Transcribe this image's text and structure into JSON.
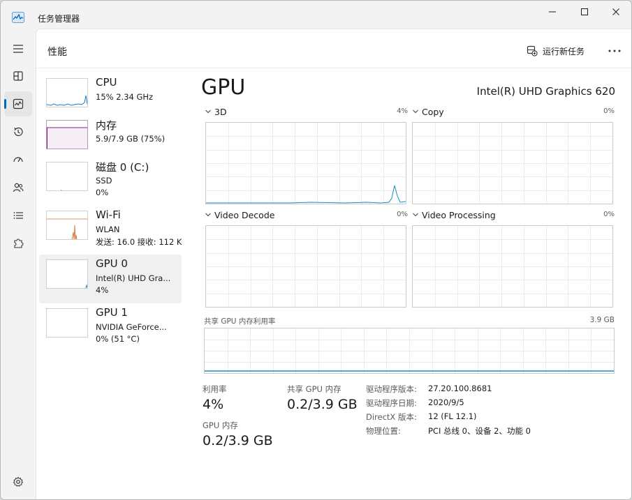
{
  "window": {
    "title": "任务管理器"
  },
  "colors": {
    "accent": "#0067c0",
    "cpu_line": "#1a7bc4",
    "memory_line": "#8b1a8b",
    "net_line": "#d4743c",
    "gpu_line": "#1a8bc4"
  },
  "nav": {
    "items": [
      {
        "name": "processes",
        "icon": "grid-icon"
      },
      {
        "name": "performance",
        "icon": "performance-icon",
        "active": true
      },
      {
        "name": "app-history",
        "icon": "history-icon"
      },
      {
        "name": "startup-apps",
        "icon": "speedometer-icon"
      },
      {
        "name": "users",
        "icon": "users-icon"
      },
      {
        "name": "details",
        "icon": "list-icon"
      },
      {
        "name": "services",
        "icon": "puzzle-icon"
      }
    ],
    "settings_icon": "gear-icon"
  },
  "header": {
    "page_title": "性能",
    "run_task": "运行新任务",
    "more_icon": "more-icon"
  },
  "devices": [
    {
      "name": "CPU",
      "line2": "15%  2.34 GHz",
      "line3": ""
    },
    {
      "name": "内存",
      "line2": "5.9/7.9 GB (75%)",
      "line3": ""
    },
    {
      "name": "磁盘 0 (C:)",
      "line2": "SSD",
      "line3": "0%"
    },
    {
      "name": "Wi-Fi",
      "line2": "WLAN",
      "line3": "发送: 16.0  接收: 112 K"
    },
    {
      "name": "GPU 0",
      "line2": "Intel(R) UHD Gra...",
      "line3": "4%"
    },
    {
      "name": "GPU 1",
      "line2": "NVIDIA GeForce...",
      "line3": "0% (51 °C)"
    }
  ],
  "gpu": {
    "title": "GPU",
    "model": "Intel(R) UHD Graphics 620",
    "engines": [
      {
        "label": "3D",
        "percent": "4%"
      },
      {
        "label": "Copy",
        "percent": "0%"
      },
      {
        "label": "Video Decode",
        "percent": "0%"
      },
      {
        "label": "Video Processing",
        "percent": "0%"
      }
    ],
    "shared_memory": {
      "label": "共享 GPU 内存利用率",
      "max": "3.9 GB"
    },
    "stats": {
      "utilization_label": "利用率",
      "utilization_value": "4%",
      "shared_mem_label": "共享 GPU 内存",
      "shared_mem_value": "0.2/3.9 GB",
      "gpu_mem_label": "GPU 内存",
      "gpu_mem_value": "0.2/3.9 GB"
    },
    "info": [
      {
        "key": "驱动程序版本:",
        "value": "27.20.100.8681"
      },
      {
        "key": "驱动程序日期:",
        "value": "2020/9/5"
      },
      {
        "key": "DirectX 版本:",
        "value": "12 (FL 12.1)"
      },
      {
        "key": "物理位置:",
        "value": "PCI 总线 0、设备 2、功能 0"
      }
    ]
  }
}
